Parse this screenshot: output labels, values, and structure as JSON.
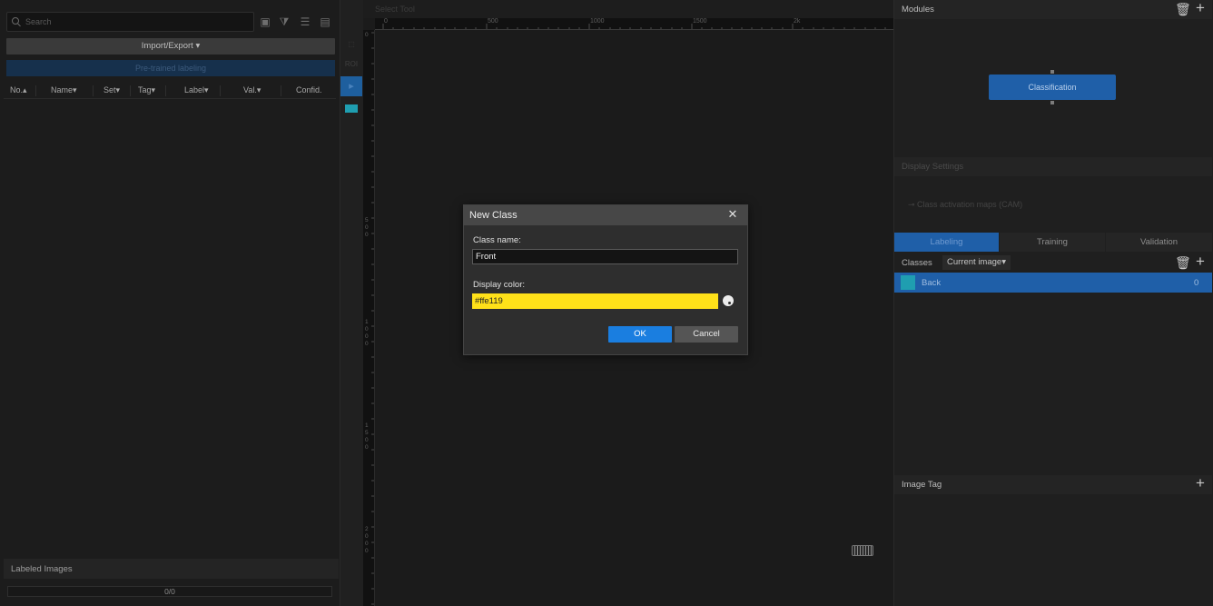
{
  "left_panel": {
    "search_placeholder": "Search",
    "import_export_label": "Import/Export ▾",
    "pretrained_label": "Pre-trained labeling",
    "columns": [
      "No.▴",
      "Name▾",
      "Set▾",
      "Tag▾",
      "Label▾",
      "Val.▾",
      "Confid."
    ],
    "labeled_images_label": "Labeled Images",
    "progress_text": "0/0"
  },
  "toolbar": {
    "select_tool_label": "Select Tool",
    "roi_label": "ROI"
  },
  "rulers": {
    "h_labels": [
      "0",
      "500",
      "1000",
      "1500",
      "2k"
    ],
    "v_labels": [
      "0",
      "500",
      "1000",
      "1500",
      "2000"
    ]
  },
  "right_panel": {
    "modules_title": "Modules",
    "classification_label": "Classification",
    "display_settings_title": "Display Settings",
    "cam_label": "Class activation maps (CAM)",
    "tabs": [
      "Labeling",
      "Training",
      "Validation"
    ],
    "classes_label": "Classes",
    "classes_dropdown": "Current image▾",
    "class_items": [
      {
        "name": "Back",
        "count": "0",
        "color": "#1f9eb0"
      }
    ],
    "image_tag_title": "Image Tag"
  },
  "dialog": {
    "title": "New Class",
    "class_name_label": "Class name:",
    "class_name_value": "Front",
    "display_color_label": "Display color:",
    "display_color_value": "#ffe119",
    "ok_label": "OK",
    "cancel_label": "Cancel"
  },
  "colors": {
    "accent": "#1a7ee0",
    "selected_class_bg": "#1f5fa8",
    "display_color": "#ffe119"
  }
}
